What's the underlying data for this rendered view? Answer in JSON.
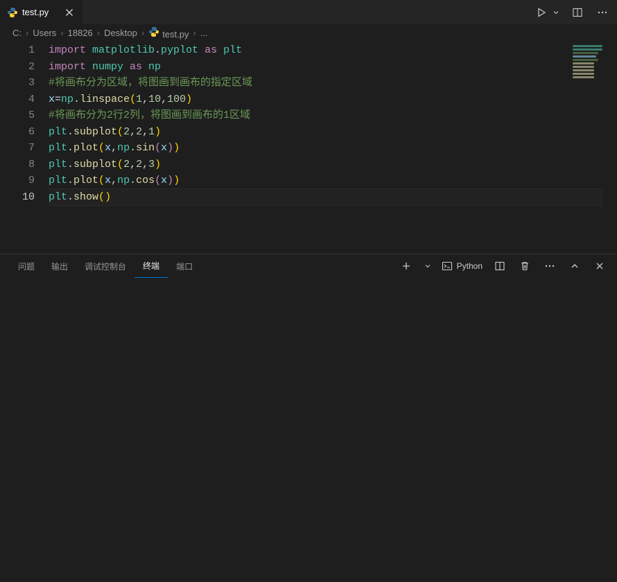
{
  "tab": {
    "filename": "test.py"
  },
  "breadcrumbs": {
    "parts": [
      "C:",
      "Users",
      "18826",
      "Desktop"
    ],
    "file": "test.py",
    "symbol": "..."
  },
  "panel": {
    "tabs": {
      "problems": "问题",
      "output": "输出",
      "debug": "调试控制台",
      "terminal": "终端",
      "ports": "端口"
    },
    "terminal_profile": "Python"
  },
  "code": {
    "lines": [
      {
        "n": 1,
        "tokens": [
          {
            "t": "import ",
            "c": "tok-kw"
          },
          {
            "t": "matplotlib",
            "c": "tok-mod"
          },
          {
            "t": ".",
            "c": "tok-pun"
          },
          {
            "t": "pyplot",
            "c": "tok-mod"
          },
          {
            "t": " as ",
            "c": "tok-kw"
          },
          {
            "t": "plt",
            "c": "tok-mod"
          }
        ]
      },
      {
        "n": 2,
        "tokens": [
          {
            "t": "import ",
            "c": "tok-kw"
          },
          {
            "t": "numpy",
            "c": "tok-mod"
          },
          {
            "t": " as ",
            "c": "tok-kw"
          },
          {
            "t": "np",
            "c": "tok-mod"
          }
        ]
      },
      {
        "n": 3,
        "tokens": [
          {
            "t": "#将画布分为区域，将图画到画布的指定区域",
            "c": "tok-cmt"
          }
        ]
      },
      {
        "n": 4,
        "tokens": [
          {
            "t": "x",
            "c": "tok-id"
          },
          {
            "t": "=",
            "c": "tok-pun"
          },
          {
            "t": "np",
            "c": "tok-mod"
          },
          {
            "t": ".",
            "c": "tok-pun"
          },
          {
            "t": "linspace",
            "c": "tok-call"
          },
          {
            "t": "(",
            "c": "tok-par"
          },
          {
            "t": "1",
            "c": "tok-num"
          },
          {
            "t": ",",
            "c": "tok-pun"
          },
          {
            "t": "10",
            "c": "tok-num"
          },
          {
            "t": ",",
            "c": "tok-pun"
          },
          {
            "t": "100",
            "c": "tok-num"
          },
          {
            "t": ")",
            "c": "tok-par"
          }
        ]
      },
      {
        "n": 5,
        "tokens": [
          {
            "t": "#将画布分为2行2列，将图画到画布的1区域",
            "c": "tok-cmt"
          }
        ]
      },
      {
        "n": 6,
        "tokens": [
          {
            "t": "plt",
            "c": "tok-mod"
          },
          {
            "t": ".",
            "c": "tok-pun"
          },
          {
            "t": "subplot",
            "c": "tok-call"
          },
          {
            "t": "(",
            "c": "tok-par"
          },
          {
            "t": "2",
            "c": "tok-num"
          },
          {
            "t": ",",
            "c": "tok-pun"
          },
          {
            "t": "2",
            "c": "tok-num"
          },
          {
            "t": ",",
            "c": "tok-pun"
          },
          {
            "t": "1",
            "c": "tok-num"
          },
          {
            "t": ")",
            "c": "tok-par"
          }
        ]
      },
      {
        "n": 7,
        "tokens": [
          {
            "t": "plt",
            "c": "tok-mod"
          },
          {
            "t": ".",
            "c": "tok-pun"
          },
          {
            "t": "plot",
            "c": "tok-call"
          },
          {
            "t": "(",
            "c": "tok-par"
          },
          {
            "t": "x",
            "c": "tok-id"
          },
          {
            "t": ",",
            "c": "tok-pun"
          },
          {
            "t": "np",
            "c": "tok-mod"
          },
          {
            "t": ".",
            "c": "tok-pun"
          },
          {
            "t": "sin",
            "c": "tok-call"
          },
          {
            "t": "(",
            "c": "tok-par2"
          },
          {
            "t": "x",
            "c": "tok-id"
          },
          {
            "t": ")",
            "c": "tok-par2"
          },
          {
            "t": ")",
            "c": "tok-par"
          }
        ]
      },
      {
        "n": 8,
        "tokens": [
          {
            "t": "plt",
            "c": "tok-mod"
          },
          {
            "t": ".",
            "c": "tok-pun"
          },
          {
            "t": "subplot",
            "c": "tok-call"
          },
          {
            "t": "(",
            "c": "tok-par"
          },
          {
            "t": "2",
            "c": "tok-num"
          },
          {
            "t": ",",
            "c": "tok-pun"
          },
          {
            "t": "2",
            "c": "tok-num"
          },
          {
            "t": ",",
            "c": "tok-pun"
          },
          {
            "t": "3",
            "c": "tok-num"
          },
          {
            "t": ")",
            "c": "tok-par"
          }
        ]
      },
      {
        "n": 9,
        "tokens": [
          {
            "t": "plt",
            "c": "tok-mod"
          },
          {
            "t": ".",
            "c": "tok-pun"
          },
          {
            "t": "plot",
            "c": "tok-call"
          },
          {
            "t": "(",
            "c": "tok-par"
          },
          {
            "t": "x",
            "c": "tok-id"
          },
          {
            "t": ",",
            "c": "tok-pun"
          },
          {
            "t": "np",
            "c": "tok-mod"
          },
          {
            "t": ".",
            "c": "tok-pun"
          },
          {
            "t": "cos",
            "c": "tok-call"
          },
          {
            "t": "(",
            "c": "tok-par2"
          },
          {
            "t": "x",
            "c": "tok-id"
          },
          {
            "t": ")",
            "c": "tok-par2"
          },
          {
            "t": ")",
            "c": "tok-par"
          }
        ]
      },
      {
        "n": 10,
        "active": true,
        "tokens": [
          {
            "t": "plt",
            "c": "tok-mod"
          },
          {
            "t": ".",
            "c": "tok-pun"
          },
          {
            "t": "show",
            "c": "tok-call"
          },
          {
            "t": "(",
            "c": "tok-par"
          },
          {
            "t": ")",
            "c": "tok-par"
          }
        ]
      }
    ]
  }
}
